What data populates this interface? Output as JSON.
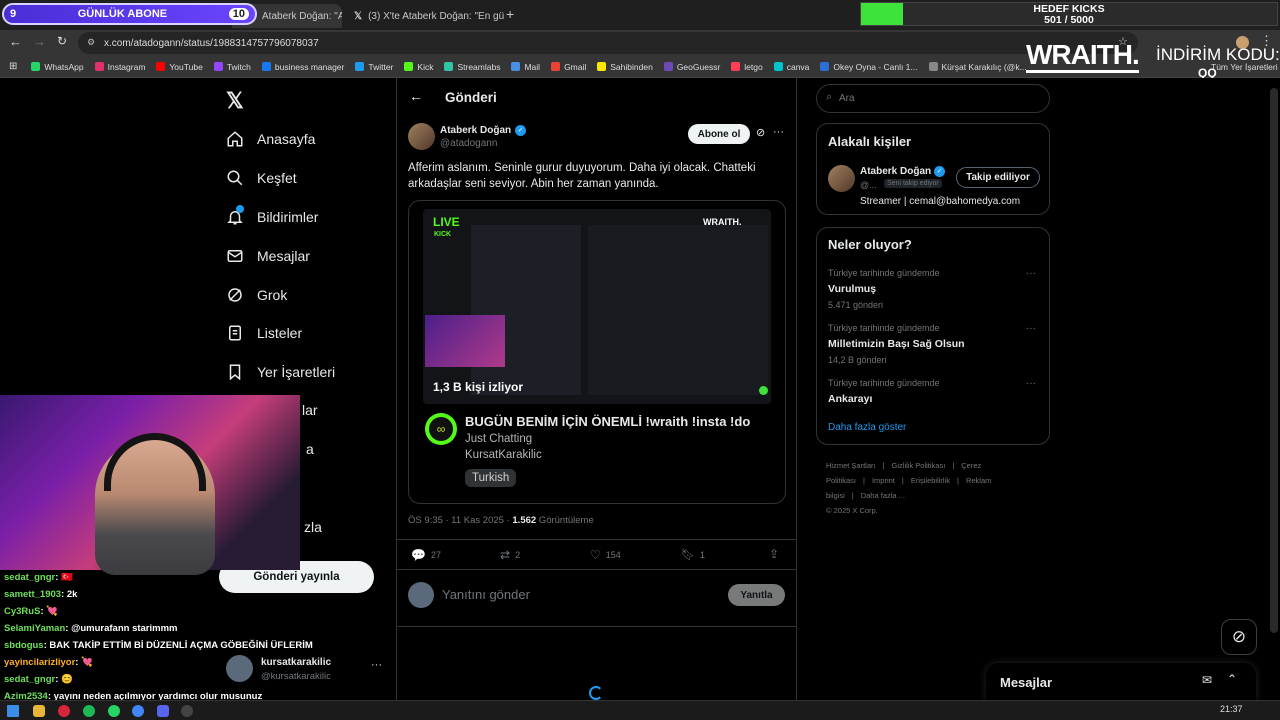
{
  "overlay": {
    "sub_goal_left": "9",
    "sub_goal_label": "GÜNLÜK ABONE",
    "sub_goal_right": "10",
    "kicks_label": "HEDEF KICKS",
    "kicks_value": "501 / 5000",
    "kicks_progress": 0.1002,
    "wraith_logo": "WRAITH.",
    "promo_label": "İNDİRİM KODU:",
    "promo_code": "QQ"
  },
  "tabs": [
    {
      "label": "Ataberk Doğan: \"Afferin",
      "active": true
    },
    {
      "label": "(3) X'te Ataberk Doğan: \"En gü",
      "active": false
    }
  ],
  "address": {
    "url": "x.com/atadogann/status/1988314757796078037"
  },
  "bookmarks": [
    {
      "label": "WhatsApp",
      "color": "#25d366"
    },
    {
      "label": "Instagram",
      "color": "#e1306c"
    },
    {
      "label": "YouTube",
      "color": "#ff0000"
    },
    {
      "label": "Twitch",
      "color": "#9146ff"
    },
    {
      "label": "business manager",
      "color": "#1877f2"
    },
    {
      "label": "Twitter",
      "color": "#1d9bf0"
    },
    {
      "label": "Kick",
      "color": "#53fc18"
    },
    {
      "label": "Streamlabs",
      "color": "#31c3a2"
    },
    {
      "label": "Mail",
      "color": "#4a90e2"
    },
    {
      "label": "Gmail",
      "color": "#ea4335"
    },
    {
      "label": "Sahibinden",
      "color": "#ffe800"
    },
    {
      "label": "GeoGuessr",
      "color": "#6c4ab6"
    },
    {
      "label": "letgo",
      "color": "#ff3f55"
    },
    {
      "label": "canva",
      "color": "#00c4cc"
    },
    {
      "label": "Okey Oyna - Canlı 1...",
      "color": "#2b6fd6"
    },
    {
      "label": "Kürşat Karakılıç (@k...",
      "color": "#888888"
    }
  ],
  "bookmarks_right": "Tüm Yer İşaretleri",
  "nav": [
    {
      "label": "Anasayfa",
      "icon": "home-icon"
    },
    {
      "label": "Keşfet",
      "icon": "search-icon"
    },
    {
      "label": "Bildirimler",
      "icon": "bell-icon"
    },
    {
      "label": "Mesajlar",
      "icon": "mail-icon"
    },
    {
      "label": "Grok",
      "icon": "grok-icon"
    },
    {
      "label": "Listeler",
      "icon": "list-icon"
    },
    {
      "label": "Yer İşaretleri",
      "icon": "bookmark-icon"
    }
  ],
  "nav_partial": [
    "lar",
    "a",
    "zla"
  ],
  "post_button": "Gönderi yayınla",
  "account": {
    "name": "kursatkarakilic",
    "handle": "@kursatkarakilic"
  },
  "header": {
    "title": "Gönderi"
  },
  "tweet": {
    "author": "Ataberk Doğan",
    "handle": "@atadogann",
    "follow": "Abone ol",
    "text": "Afferim aslanım. Seninle gurur duyuyorum. Daha iyi olacak. Chatteki arkadaşlar seni seviyor. Abin her zaman yanında.",
    "meta_time": "ÖS 9:35 · 11 Kas 2025 · ",
    "views": "1.562",
    "views_label": " Görüntüleme",
    "replies": "27",
    "retweets": "2",
    "likes": "154",
    "bookmarks": "1"
  },
  "card": {
    "live": "LIVE",
    "kick": "KICK",
    "watchers": "1,3 B kişi izliyor",
    "title": "BUGÜN BENİM İÇİN ÖNEMLİ !wraith !insta !do",
    "category": "Just Chatting",
    "channel": "KursatKarakilic",
    "tag": "Turkish",
    "thumb_wraith": "WRAITH."
  },
  "reply": {
    "placeholder": "Yanıtını gönder",
    "button": "Yanıtla"
  },
  "search": {
    "placeholder": "Ara"
  },
  "related": {
    "title": "Alakalı kişiler",
    "name": "Ataberk Doğan",
    "handle": "@...",
    "follows_you": "Seni takip ediyor",
    "follow_button": "Takip ediliyor",
    "bio": "Streamer | cemal@bahomedya.com"
  },
  "trends": {
    "title": "Neler oluyor?",
    "items": [
      {
        "context": "Türkiye tarihinde gündemde",
        "name": "Vurulmuş",
        "count": "5.471 gönderi"
      },
      {
        "context": "Türkiye tarihinde gündemde",
        "name": "Milletimizin Başı Sağ Olsun",
        "count": "14,2 B gönderi"
      },
      {
        "context": "Türkiye tarihinde gündemde",
        "name": "Ankarayı",
        "count": ""
      }
    ],
    "more": "Daha fazla göster"
  },
  "footer": {
    "links": [
      "Hizmet Şartları",
      "|",
      "Gizlilik Politikası",
      "|",
      "Çerez Politikası",
      "|",
      "Imprint",
      "|",
      "Erişilebilirlik",
      "|",
      "Reklam bilgisi",
      "|",
      "Daha fazla ..."
    ],
    "copyright": "© 2025 X Corp."
  },
  "dm_bar": {
    "title": "Mesajlar"
  },
  "chat": [
    {
      "user": "sedat_gngr",
      "msg": "🇹🇷",
      "color": "#6ee05a"
    },
    {
      "user": "samett_1903",
      "msg": "2k",
      "color": "#6ee05a"
    },
    {
      "user": "Cy3RuS",
      "msg": "💘",
      "color": "#6ee05a"
    },
    {
      "user": "SelamiYaman",
      "msg": "@umurafann starimmm",
      "color": "#6ee05a"
    },
    {
      "user": "sbdogus",
      "msg": "BAK TAKİP ETTİM Bİ DÜZENLİ AÇMA GÖBEĞİNİ ÜFLERİM",
      "color": "#6ee05a"
    },
    {
      "user": "yayincilarizliyor",
      "msg": "💘",
      "color": "#ffb020"
    },
    {
      "user": "sedat_gngr",
      "msg": "😊",
      "color": "#6ee05a"
    },
    {
      "user": "Azim2534",
      "msg": "yayını neden açılmıyor yardımcı olur musunuz",
      "color": "#6ee05a"
    }
  ],
  "clock": "21:37"
}
